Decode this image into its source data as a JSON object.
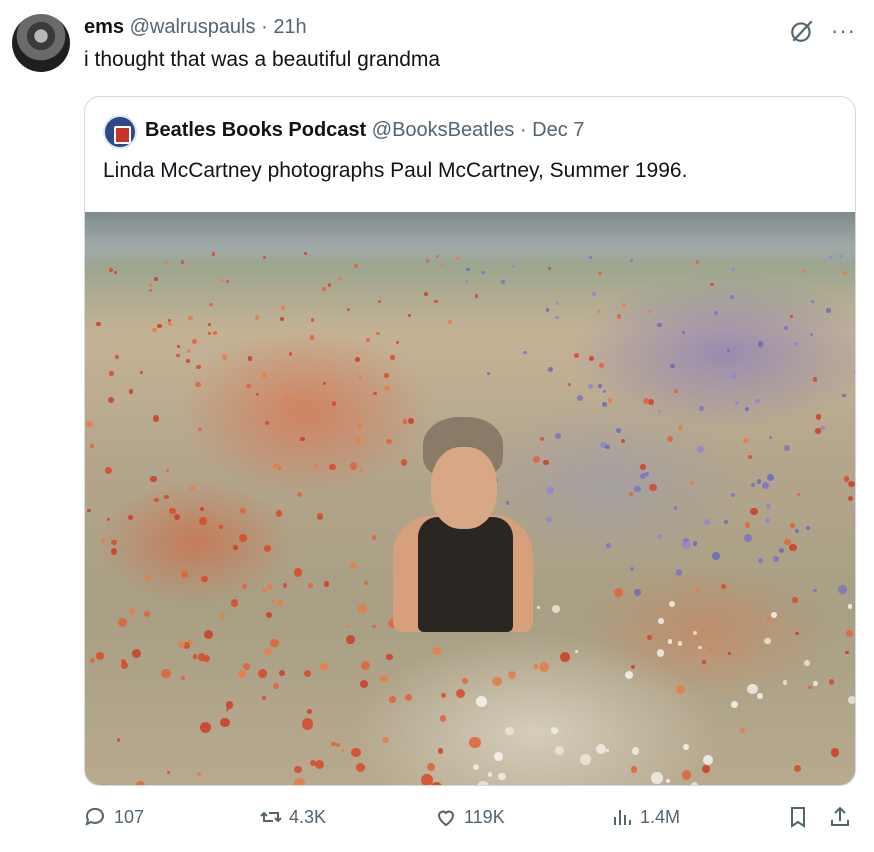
{
  "tweet": {
    "display_name": "ems",
    "handle": "@walruspauls",
    "separator": "·",
    "time": "21h",
    "text": "i thought that was a beautiful grandma"
  },
  "quoted": {
    "display_name": "Beatles Books Podcast",
    "handle": "@BooksBeatles",
    "separator": "·",
    "date": "Dec 7",
    "text": "Linda McCartney photographs Paul McCartney,  Summer 1996."
  },
  "metrics": {
    "replies": "107",
    "reposts": "4.3K",
    "likes": "119K",
    "views": "1.4M"
  },
  "icons": {
    "more": "more-icon",
    "grok": "grok-icon",
    "reply": "reply-icon",
    "repost": "repost-icon",
    "like": "heart-icon",
    "views": "views-icon",
    "bookmark": "bookmark-icon",
    "share": "share-icon"
  },
  "colors": {
    "text": "#0f1419",
    "muted": "#536471",
    "border": "#cfd9de"
  }
}
